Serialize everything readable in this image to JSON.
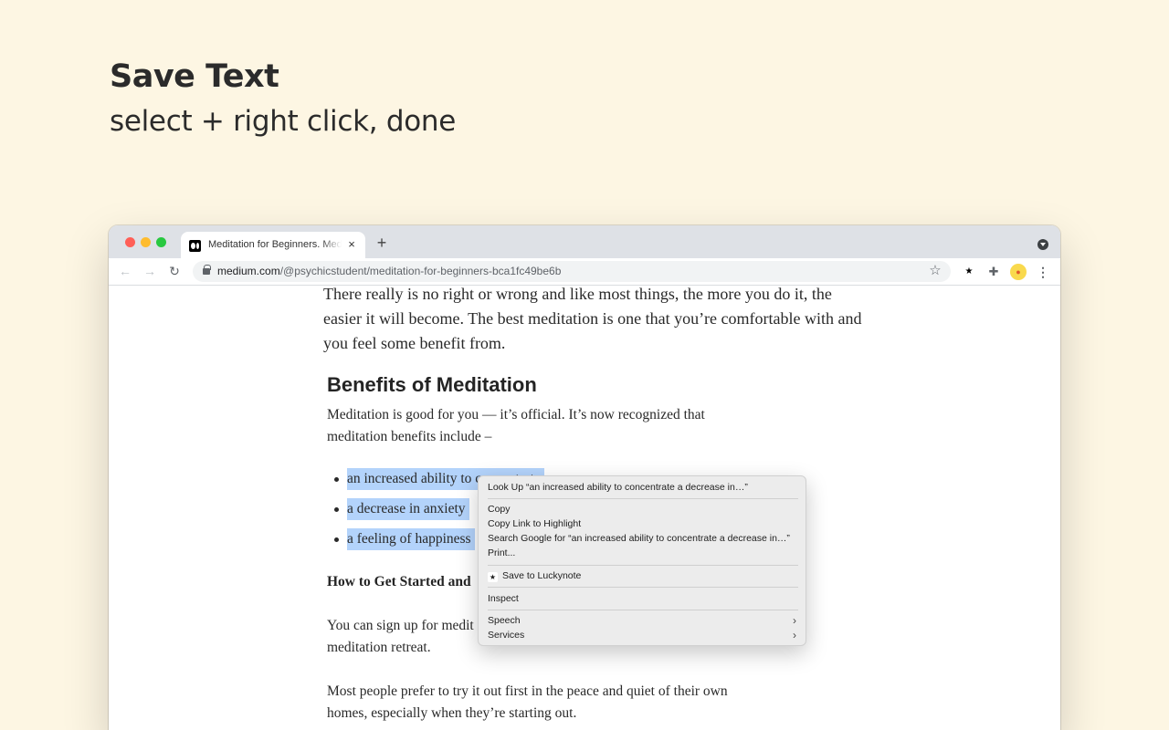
{
  "hero": {
    "title": "Save Text",
    "subtitle": "select + right click, done"
  },
  "browser": {
    "tab": {
      "title": "Meditation for Beginners. Medi",
      "close": "×"
    },
    "new_tab": "+",
    "nav": {
      "back": "←",
      "forward": "→",
      "reload": "↻"
    },
    "url": {
      "host": "medium.com",
      "path": "/@psychicstudent/meditation-for-beginners-bca1fc49be6b"
    },
    "star": "☆",
    "extensions": {
      "lucky": "★",
      "puzzle": "✚",
      "avatar": "●",
      "menu": "⋮"
    }
  },
  "article": {
    "intro": "There really is no right or wrong and like most things, the more you do it, the easier it will become. The best meditation is one that you’re comfortable with and you feel some benefit from.",
    "heading": "Benefits of Meditation",
    "paragraph": "Meditation is good for you — it’s official. It’s now recognized that meditation benefits include –",
    "bullets": [
      "an increased ability to concentrate",
      "a decrease in anxiety",
      "a feeling of happiness"
    ],
    "subheading": "How to Get Started and",
    "p3": "You can sign up for medit... meditation retreat.",
    "p3_line1": "You can sign up for medit",
    "p3_line2": "meditation retreat.",
    "p4": "Most people prefer to try it out first in the peace and quiet of their own homes, especially when they’re starting out."
  },
  "context_menu": {
    "look_up": "Look Up “an increased ability to concentrate a decrease in…”",
    "copy": "Copy",
    "copy_link": "Copy Link to Highlight",
    "search_google": "Search Google for “an increased ability to concentrate a decrease in…”",
    "print": "Print...",
    "save_luckynote": "Save to Luckynote",
    "inspect": "Inspect",
    "speech": "Speech",
    "services": "Services",
    "chevron": "›"
  },
  "colors": {
    "background": "#fdf6e3",
    "selection": "#b3d3fb",
    "tabbar": "#dee1e6"
  }
}
